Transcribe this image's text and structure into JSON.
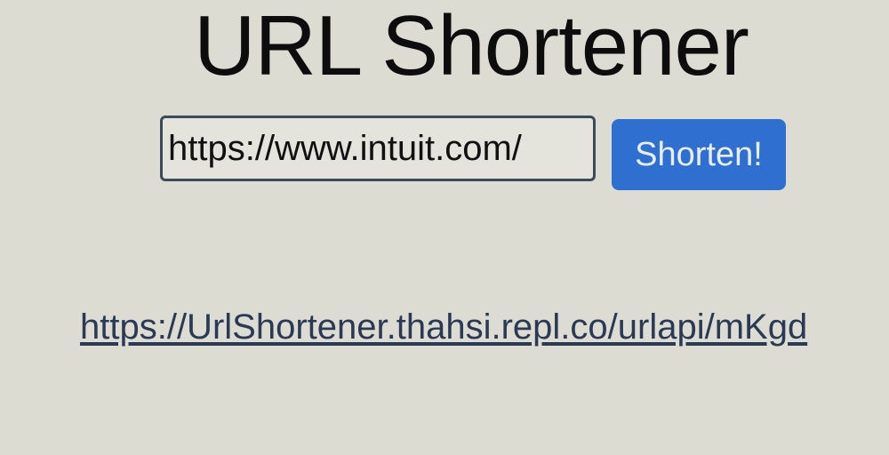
{
  "page": {
    "title": "URL Shortener"
  },
  "form": {
    "url_value": "https://www.intuit.com/",
    "button_label": "Shorten!"
  },
  "result": {
    "short_url": "https://UrlShortener.thahsi.repl.co/urlapi/mKgd"
  },
  "colors": {
    "background": "#dcdcd2",
    "button": "#2e6fd0",
    "link": "#2a3a55"
  }
}
